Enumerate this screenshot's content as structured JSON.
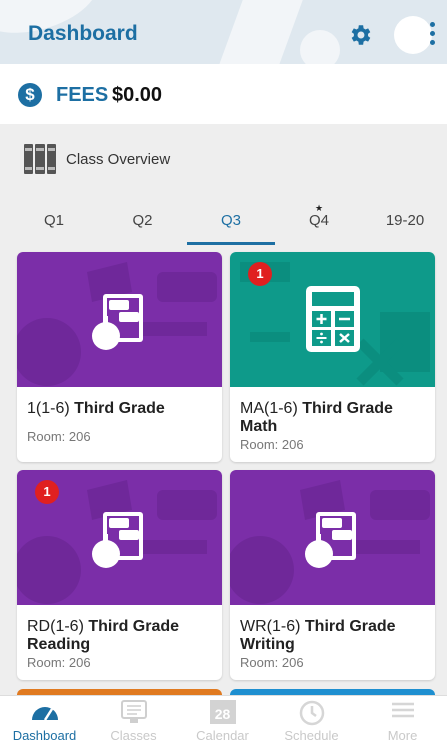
{
  "header": {
    "title": "Dashboard",
    "settings_icon": "gear-icon",
    "menu_icon": "more-vert-icon"
  },
  "fees": {
    "label": "FEES",
    "amount": "$0.00",
    "icon_glyph": "$"
  },
  "overview": {
    "title": "Class Overview",
    "icon": "books-icon"
  },
  "tabs": [
    {
      "label": "Q1",
      "active": false
    },
    {
      "label": "Q2",
      "active": false
    },
    {
      "label": "Q3",
      "active": true
    },
    {
      "label": "Q4",
      "active": false,
      "starred": true,
      "star": "★"
    },
    {
      "label": "19-20",
      "active": false
    }
  ],
  "classes": [
    {
      "code": "1(1-6)",
      "name": "Third Grade",
      "room": "Room: 206",
      "badge": null,
      "color": "#7b2ea8",
      "icon": "apple-book-icon"
    },
    {
      "code": "MA(1-6)",
      "name": "Third Grade Math",
      "room": "Room: 206",
      "badge": "1",
      "color": "#0e9a8a",
      "icon": "calculator-icon"
    },
    {
      "code": "RD(1-6)",
      "name": "Third Grade Reading",
      "room": "Room: 206",
      "badge": "1",
      "color": "#7b2ea8",
      "icon": "apple-book-icon"
    },
    {
      "code": "WR(1-6)",
      "name": "Third Grade Writing",
      "room": "Room: 206",
      "badge": null,
      "color": "#7b2ea8",
      "icon": "apple-book-icon"
    }
  ],
  "bottom_nav": [
    {
      "label": "Dashboard",
      "active": true,
      "icon": "speedometer-icon"
    },
    {
      "label": "Classes",
      "active": false,
      "icon": "monitor-icon"
    },
    {
      "label": "Calendar",
      "active": false,
      "icon": "calendar-icon",
      "calendar_day": "28"
    },
    {
      "label": "Schedule",
      "active": false,
      "icon": "clock-icon"
    },
    {
      "label": "More",
      "active": false,
      "icon": "hamburger-icon"
    }
  ],
  "colors": {
    "accent": "#1d6fa3",
    "purple": "#7b2ea8",
    "teal": "#0e9a8a",
    "badge": "#e02020",
    "orange_peek": "#e07a20",
    "blue_peek": "#1e8fd0"
  }
}
